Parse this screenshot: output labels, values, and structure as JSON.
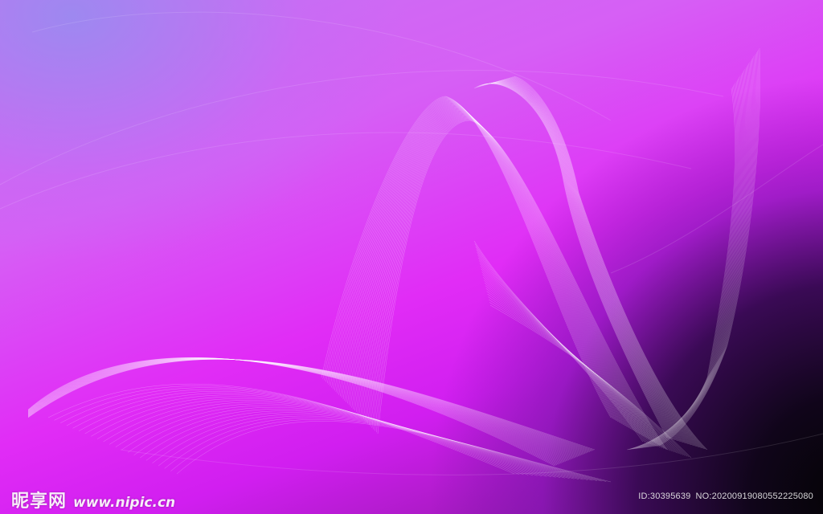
{
  "watermark": {
    "brand": "昵享网",
    "url": "www.nipic.cn",
    "id_text": "ID:30395639",
    "no_text": "NO:20200919080552225080"
  },
  "colors": {
    "top_left_haze": "#968cf0",
    "mid_magenta": "#e12cf6",
    "bottom_right_dark": "#030403",
    "line_color": "#ffffff"
  }
}
